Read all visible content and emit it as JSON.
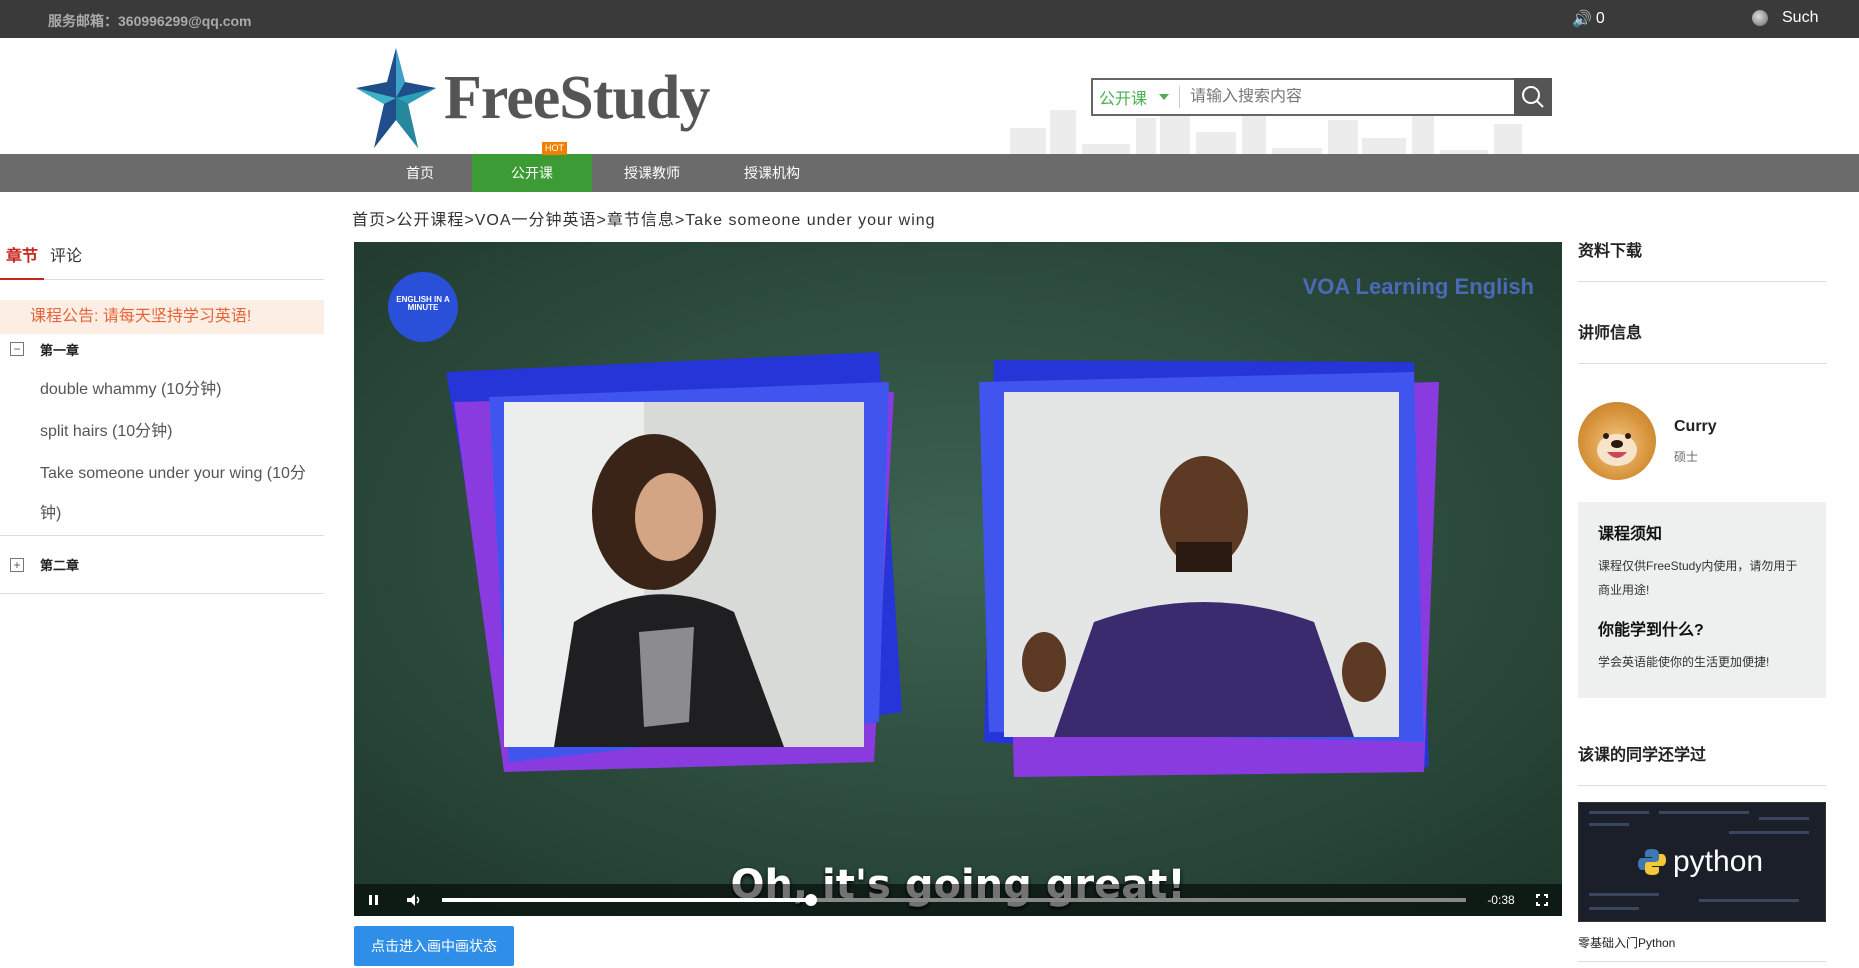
{
  "topbar": {
    "email": "服务邮箱：360996299@qq.com",
    "message_count": "0",
    "username": "Such"
  },
  "header": {
    "logo_text": "FreeStudy",
    "search": {
      "category": "公开课",
      "placeholder": "请输入搜索内容"
    }
  },
  "nav": {
    "items": [
      {
        "label": "首页"
      },
      {
        "label": "公开课"
      },
      {
        "label": "授课教师"
      },
      {
        "label": "授课机构"
      }
    ],
    "active_index": 1,
    "hot_badge": "HOT"
  },
  "breadcrumb": [
    "首页",
    "公开课程",
    "VOA一分钟英语",
    "章节信息",
    "Take someone under your wing"
  ],
  "breadcrumb_sep": ">",
  "left": {
    "tabs": [
      {
        "label": "章节"
      },
      {
        "label": "评论"
      }
    ],
    "notice": "课程公告: 请每天坚持学习英语!",
    "chapters": [
      {
        "title": "第一章",
        "expanded": true,
        "lessons": [
          "double whammy (10分钟)",
          "split hairs (10分钟)",
          "Take someone under your wing (10分钟)"
        ]
      },
      {
        "title": "第二章",
        "expanded": false,
        "lessons": []
      }
    ]
  },
  "video": {
    "subtitle": "Oh, it's going great!",
    "brand": "VOA Learning English",
    "badge": "ENGLISH IN A MINUTE",
    "time_remaining": "-0:38",
    "progress": 0.36
  },
  "pip_button": "点击进入画中画状态",
  "right": {
    "downloads_title": "资料下载",
    "teacher_title": "讲师信息",
    "teacher": {
      "name": "Curry",
      "degree": "硕士"
    },
    "notice_title": "课程须知",
    "notice_text": "课程仅供FreeStudy内使用，请勿用于商业用途!",
    "learn_title": "你能学到什么?",
    "learn_text": "学会英语能使你的生活更加便捷!",
    "also_title": "该课的同学还学过",
    "also_course": {
      "thumb_text": "python",
      "caption": "零基础入门Python"
    }
  },
  "colors": {
    "nav_active": "#3d9b35",
    "accent_red": "#c8251e",
    "pip_blue": "#2f8fe8"
  }
}
